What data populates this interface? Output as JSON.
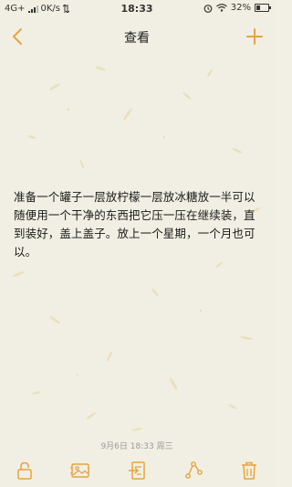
{
  "status_bar": {
    "network": "4G+",
    "speed": "0K/s",
    "time": "18:33",
    "battery": "32%",
    "battery_level": 0.32
  },
  "nav": {
    "title": "查看",
    "back_icon": "chevron-left-icon",
    "add_icon": "plus-icon"
  },
  "note": {
    "content": "准备一个罐子一层放柠檬一层放冰糖放一半可以随便用一个干净的东西把它压一压在继续装，直到装好，盖上盖子。放上一个星期，一个月也可以。",
    "timestamp": "9月6日 18:33 周三"
  },
  "toolbar": {
    "items": [
      "lock-icon",
      "image-icon",
      "export-icon",
      "share-icon",
      "trash-icon"
    ]
  },
  "colors": {
    "accent": "#e8a33c",
    "paper": "#f1efe3",
    "text": "#1a1a1a"
  }
}
